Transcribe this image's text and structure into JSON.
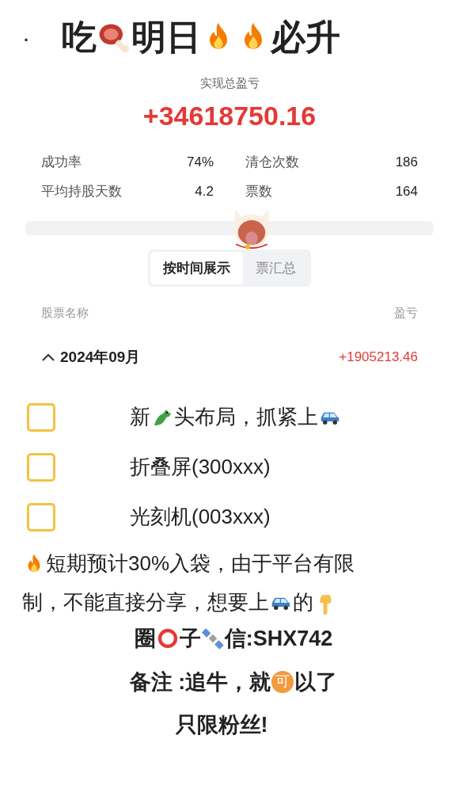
{
  "title": {
    "bullet": "·",
    "parts": [
      {
        "kind": "text",
        "text": "吃"
      },
      {
        "kind": "meat"
      },
      {
        "kind": "text",
        "text": "明日"
      },
      {
        "kind": "fire"
      },
      {
        "kind": "fire"
      },
      {
        "kind": "text",
        "text": "必升"
      }
    ]
  },
  "summary": {
    "label": "实现总盈亏",
    "value": "+34618750.16"
  },
  "stats": [
    {
      "label": "成功率",
      "value": "74%"
    },
    {
      "label": "清仓次数",
      "value": "186"
    },
    {
      "label": "平均持股天数",
      "value": "4.2"
    },
    {
      "label": "票数",
      "value": "164"
    }
  ],
  "tabs": [
    {
      "label": "按时间展示",
      "selected": true
    },
    {
      "label": "票汇总",
      "selected": false
    }
  ],
  "table": {
    "columns": [
      "股票名称",
      "盈亏"
    ],
    "group": {
      "expanded": true,
      "label": "2024年09月",
      "value": "+1905213.46"
    }
  },
  "checklist": [
    {
      "checked": false,
      "parts": [
        {
          "kind": "text",
          "text": "新"
        },
        {
          "kind": "dragon"
        },
        {
          "kind": "text",
          "text": "头布局，抓紧上"
        },
        {
          "kind": "car"
        }
      ]
    },
    {
      "checked": false,
      "parts": [
        {
          "kind": "text",
          "text": "折叠屏(300xxx)"
        }
      ]
    },
    {
      "checked": false,
      "parts": [
        {
          "kind": "text",
          "text": "光刻机(003xxx)"
        }
      ]
    }
  ],
  "note": [
    [
      {
        "kind": "fire"
      },
      {
        "kind": "text",
        "text": "短期预计30%入袋，由于平台有限"
      }
    ],
    [
      {
        "kind": "text",
        "text": "制，不能直接分享，想要上"
      },
      {
        "kind": "car"
      },
      {
        "kind": "text",
        "text": "的"
      },
      {
        "kind": "hand"
      }
    ]
  ],
  "contact": [
    {
      "kind": "text",
      "text": "圈"
    },
    {
      "kind": "ring"
    },
    {
      "kind": "text",
      "text": "子"
    },
    {
      "kind": "satellite"
    },
    {
      "kind": "text",
      "text": "信:SHX742"
    }
  ],
  "remark": [
    {
      "kind": "text",
      "text": "备注 :追牛，就"
    },
    {
      "kind": "badge",
      "text": "可"
    },
    {
      "kind": "text",
      "text": "以了"
    }
  ],
  "footer": "只限粉丝!"
}
